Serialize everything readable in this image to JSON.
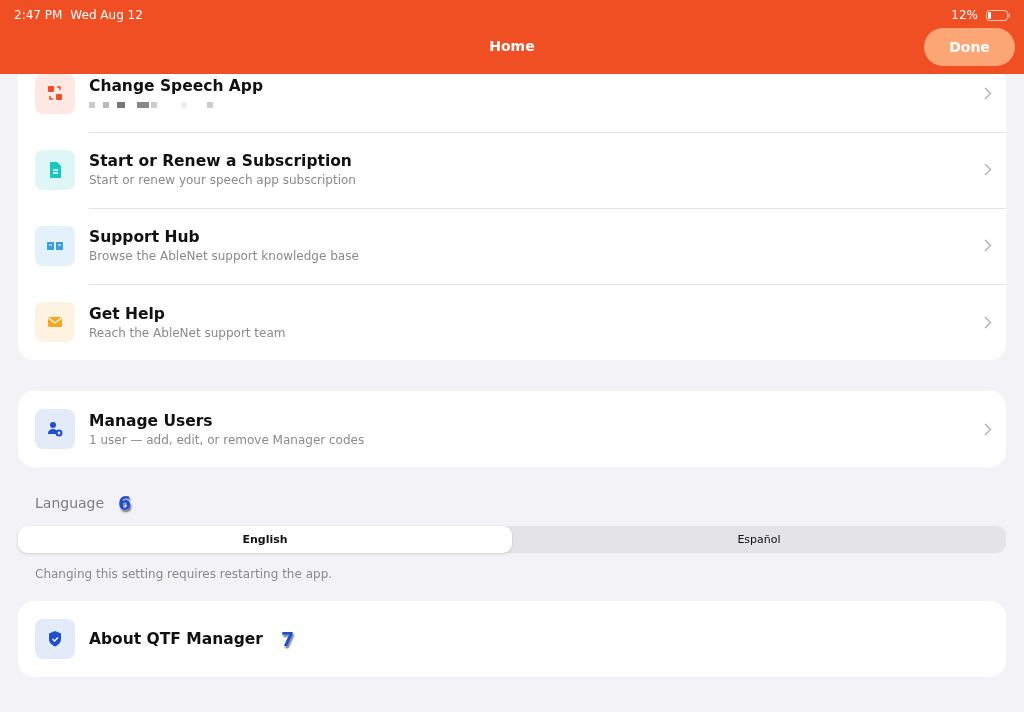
{
  "status_bar": {
    "time": "2:47 PM",
    "date": "Wed Aug 12",
    "battery": "12%"
  },
  "nav": {
    "title": "Home",
    "done": "Done"
  },
  "groups": [
    {
      "items": [
        {
          "kind": "swap",
          "title": "Change Speech App"
        },
        {
          "kind": "doc",
          "title": "Start or Renew a Subscription",
          "subtitle": "Start or renew your speech app subscription"
        },
        {
          "kind": "book",
          "title": "Support Hub",
          "subtitle": "Browse the AbleNet support knowledge base"
        },
        {
          "kind": "mail",
          "title": "Get Help",
          "subtitle": "Reach the AbleNet support team"
        }
      ]
    },
    {
      "items": [
        {
          "kind": "user",
          "title": "Manage Users",
          "subtitle": "1 user — add, edit, or remove Manager codes"
        }
      ]
    }
  ],
  "language": {
    "label": "Language",
    "marker": "6",
    "options": [
      {
        "label": "English",
        "selected": true
      },
      {
        "label": "Español",
        "selected": false
      }
    ],
    "note": "Changing this setting requires restarting the app."
  },
  "about": {
    "title": "About QTF Manager",
    "marker": "7"
  }
}
